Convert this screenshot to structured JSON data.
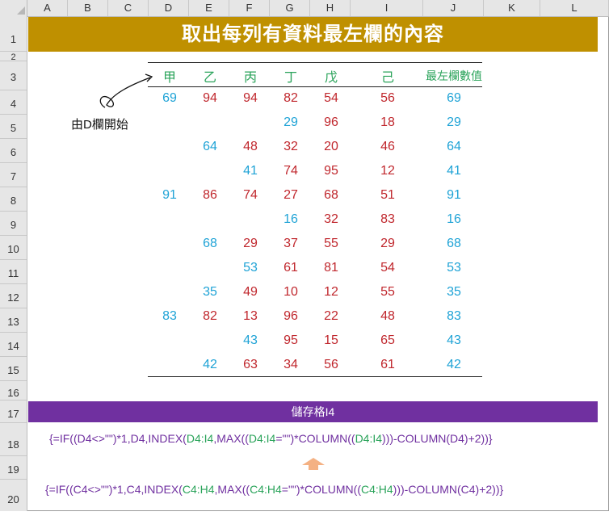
{
  "columns": [
    "A",
    "B",
    "C",
    "D",
    "E",
    "F",
    "G",
    "H",
    "I",
    "J",
    "K",
    "L"
  ],
  "rows": [
    "1",
    "2",
    "3",
    "4",
    "5",
    "6",
    "7",
    "8",
    "9",
    "10",
    "11",
    "12",
    "13",
    "14",
    "15",
    "16",
    "17",
    "18",
    "19",
    "20"
  ],
  "title": "取出每列有資料最左欄的內容",
  "table": {
    "headers": [
      "甲",
      "乙",
      "丙",
      "丁",
      "戊",
      "己",
      "最左欄數值"
    ],
    "rows": [
      [
        "69",
        "94",
        "94",
        "82",
        "54",
        "56",
        "69"
      ],
      [
        "",
        "",
        "",
        "29",
        "96",
        "18",
        "29"
      ],
      [
        "",
        "64",
        "48",
        "32",
        "20",
        "46",
        "64"
      ],
      [
        "",
        "",
        "41",
        "74",
        "95",
        "12",
        "41"
      ],
      [
        "91",
        "86",
        "74",
        "27",
        "68",
        "51",
        "91"
      ],
      [
        "",
        "",
        "",
        "16",
        "32",
        "83",
        "16"
      ],
      [
        "",
        "68",
        "29",
        "37",
        "55",
        "29",
        "68"
      ],
      [
        "",
        "",
        "53",
        "61",
        "81",
        "54",
        "53"
      ],
      [
        "",
        "35",
        "49",
        "10",
        "12",
        "55",
        "35"
      ],
      [
        "83",
        "82",
        "13",
        "96",
        "22",
        "48",
        "83"
      ],
      [
        "",
        "",
        "43",
        "95",
        "15",
        "65",
        "43"
      ],
      [
        "",
        "42",
        "63",
        "34",
        "56",
        "61",
        "42"
      ]
    ],
    "first_cells": [
      {
        "row": 0,
        "col": 0
      },
      {
        "row": 1,
        "col": 3
      },
      {
        "row": 2,
        "col": 1
      },
      {
        "row": 3,
        "col": 2
      },
      {
        "row": 4,
        "col": 0
      },
      {
        "row": 5,
        "col": 3
      },
      {
        "row": 6,
        "col": 1
      },
      {
        "row": 7,
        "col": 2
      },
      {
        "row": 8,
        "col": 1
      },
      {
        "row": 9,
        "col": 0
      },
      {
        "row": 10,
        "col": 2
      },
      {
        "row": 11,
        "col": 1
      }
    ]
  },
  "annotation": "由D欄開始",
  "cell_label": "儲存格I4",
  "formula1": {
    "p1": "{=IF((",
    "g1": "D4",
    "p2": "<>\"\")*1,D4,INDEX(",
    "g2": "D4:I4",
    "p3": ",MAX((",
    "g3": "D4:I4",
    "p4": "=\"\")*COLUMN((",
    "g4": "D4:I4",
    "p5": ")))-COLUMN(D4)+2))}"
  },
  "formula2": {
    "p1": "{=IF((C4<>\"\")*1,C4,INDEX(",
    "g1": "C4:H4",
    "p2": ",MAX((",
    "g2": "C4:H4",
    "p3": "=\"\")*COLUMN((",
    "g3": "C4:H4",
    "p4": ")))-COLUMN(C4)+2))}"
  },
  "colors": {
    "banner": "#bf9000",
    "cellbar": "#7030a0",
    "header_green": "#2aa35a",
    "value_red": "#c0272d",
    "value_blue": "#1fa3d6",
    "arrow": "#f4b183"
  }
}
